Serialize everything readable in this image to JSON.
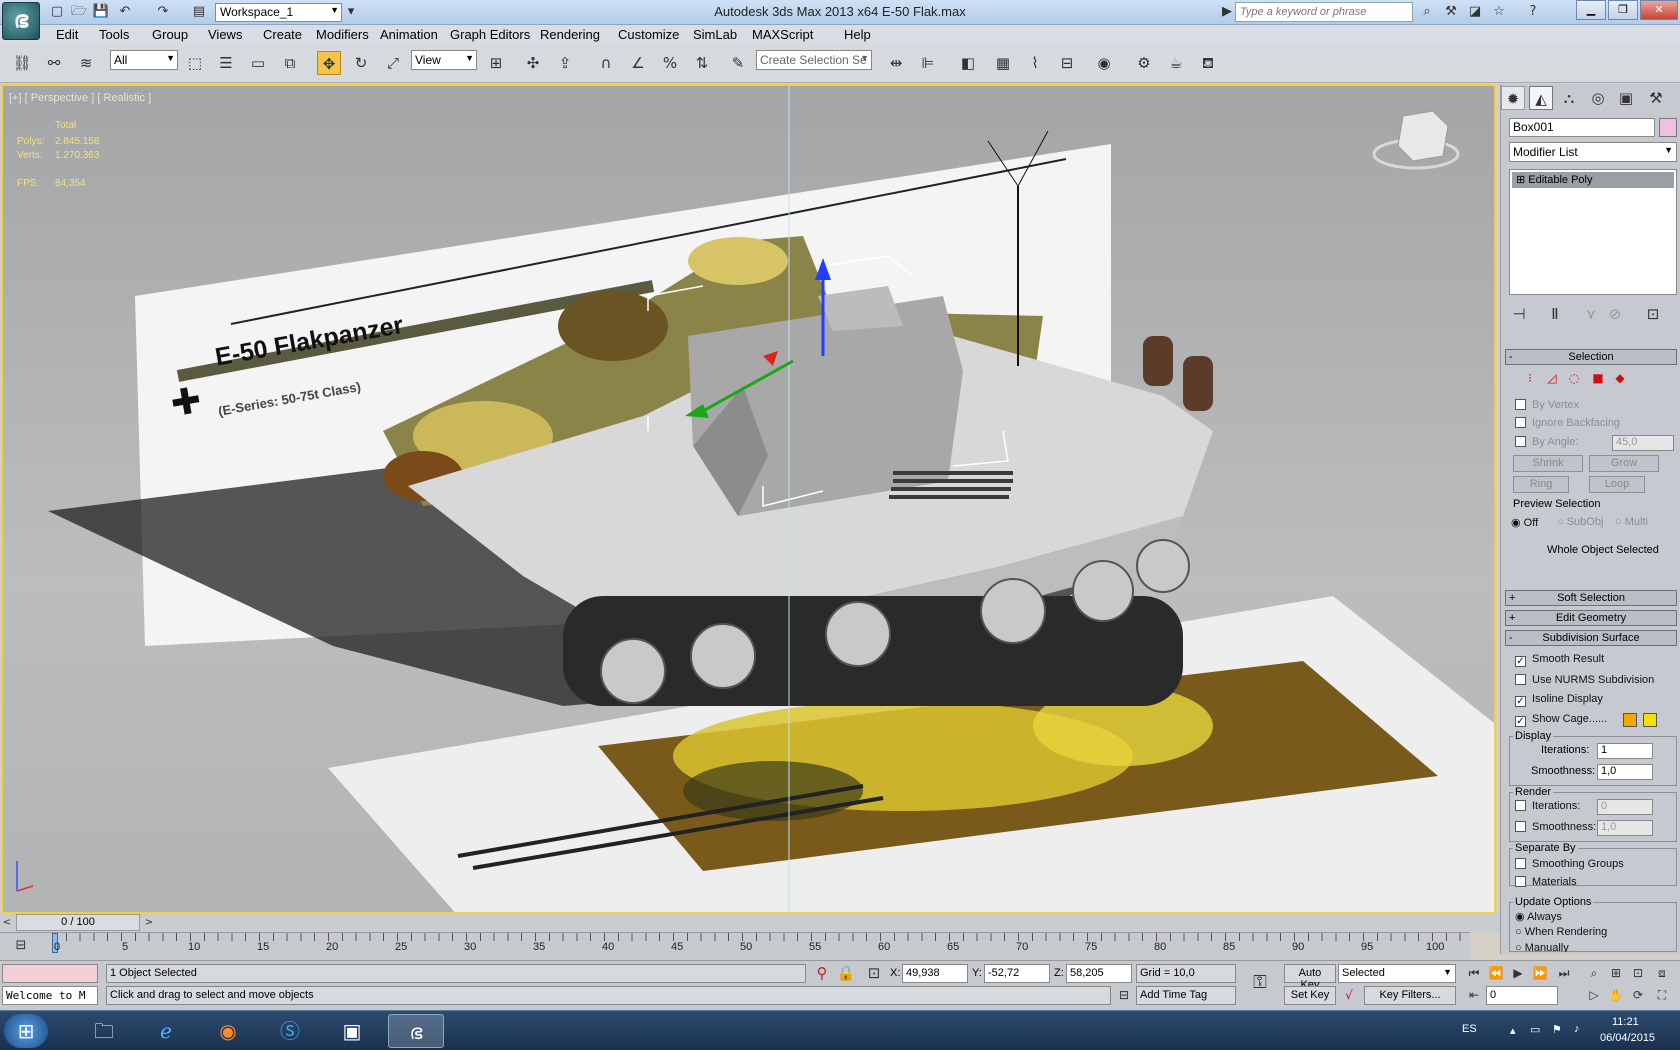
{
  "window": {
    "title": "Autodesk 3ds Max  2013 x64     E-50 Flak.max",
    "workspace": "Workspace_1",
    "search_placeholder": "Type a keyword or phrase"
  },
  "menu": [
    "Edit",
    "Tools",
    "Group",
    "Views",
    "Create",
    "Modifiers",
    "Animation",
    "Graph Editors",
    "Rendering",
    "Customize",
    "SimLab",
    "MAXScript",
    "Help"
  ],
  "toolbar": {
    "selection_filter": "All",
    "ref_coord": "View",
    "named_selection": "Create Selection Se"
  },
  "viewport": {
    "label": "[+] [ Perspective ] [ Realistic ]",
    "stats": {
      "total_label": "Total",
      "polys_label": "Polys:",
      "polys": "2.845.158",
      "verts_label": "Verts:",
      "verts": "1.270.363",
      "fps_label": "FPS:",
      "fps": "84,354"
    },
    "poster_title": "E-50 Flakpanzer",
    "poster_subtitle": "(E-Series: 50-75t Class)"
  },
  "command_panel": {
    "object_name": "Box001",
    "modifier_list": "Modifier List",
    "stack_item": "Editable Poly",
    "selection": {
      "title": "Selection",
      "by_vertex": "By Vertex",
      "ignore_backfacing": "Ignore Backfacing",
      "by_angle": "By Angle:",
      "angle_value": "45,0",
      "shrink": "Shrink",
      "grow": "Grow",
      "ring": "Ring",
      "loop": "Loop",
      "preview_label": "Preview Selection",
      "preview_off": "Off",
      "preview_subobj": "SubObj",
      "preview_multi": "Multi",
      "status": "Whole Object Selected"
    },
    "soft_selection": "Soft Selection",
    "edit_geometry": "Edit Geometry",
    "subdivision": {
      "title": "Subdivision Surface",
      "smooth_result": "Smooth Result",
      "use_nurms": "Use NURMS Subdivision",
      "isoline": "Isoline Display",
      "show_cage": "Show Cage......",
      "display_label": "Display",
      "iterations_label": "Iterations:",
      "display_iterations": "1",
      "smoothness_label": "Smoothness:",
      "display_smoothness": "1,0",
      "render_label": "Render",
      "render_iterations": "0",
      "render_smoothness": "1,0",
      "separate_by": "Separate By",
      "smoothing_groups": "Smoothing Groups",
      "materials": "Materials",
      "update_options": "Update Options",
      "always": "Always",
      "when_rendering": "When Rendering",
      "manually": "Manually"
    }
  },
  "timeline": {
    "slider": "0 / 100",
    "ticks": [
      "0",
      "5",
      "10",
      "15",
      "20",
      "25",
      "30",
      "35",
      "40",
      "45",
      "50",
      "55",
      "60",
      "65",
      "70",
      "75",
      "80",
      "85",
      "90",
      "95",
      "100"
    ]
  },
  "status": {
    "maxscript": "Welcome to M",
    "selected": "1 Object Selected",
    "prompt": "Click and drag to select and move objects",
    "x_label": "X:",
    "x": "49,938",
    "y_label": "Y:",
    "y": "-52,72",
    "z_label": "Z:",
    "z": "58,205",
    "grid": "Grid = 10,0",
    "add_time_tag": "Add Time Tag",
    "auto_key": "Auto Key",
    "set_key": "Set Key",
    "key_mode": "Selected",
    "key_filters": "Key Filters...",
    "frame": "0"
  },
  "taskbar": {
    "lang": "ES",
    "time": "11:21",
    "date": "06/04/2015"
  }
}
